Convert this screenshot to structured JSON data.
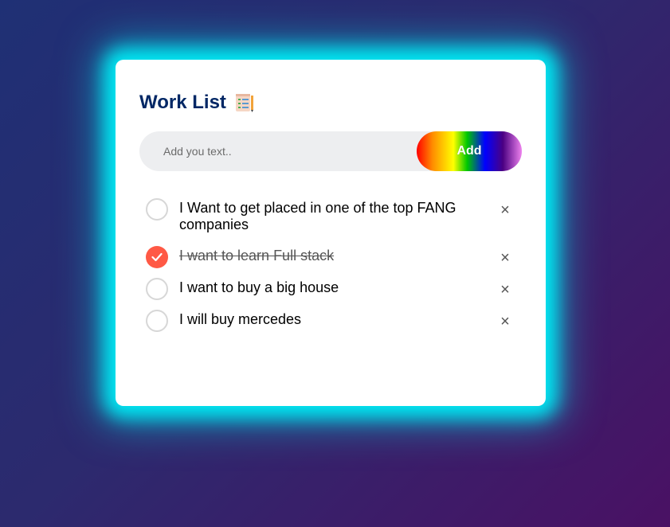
{
  "header": {
    "title": "Work List",
    "icon": "clipboard-list-icon"
  },
  "input": {
    "placeholder": "Add you text..",
    "value": "",
    "add_label": "Add"
  },
  "tasks": [
    {
      "text": "I Want to get placed in one of the top FANG companies",
      "checked": false
    },
    {
      "text": "I want to learn Full stack",
      "checked": true
    },
    {
      "text": "I want to buy a big house",
      "checked": false
    },
    {
      "text": "I will buy mercedes",
      "checked": false
    }
  ],
  "delete_symbol": "×",
  "colors": {
    "accent": "#ff5945",
    "title": "#002765",
    "glow": "#00e7f2",
    "input_bg": "#edeef0"
  }
}
